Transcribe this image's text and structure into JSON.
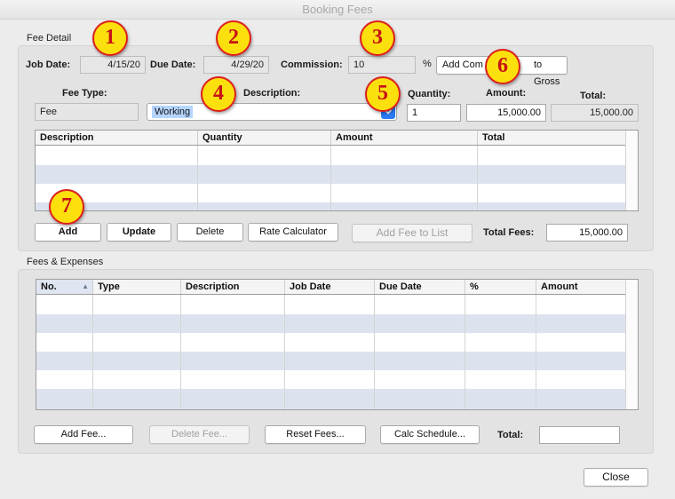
{
  "window": {
    "title": "Booking Fees"
  },
  "fee_detail": {
    "section_title": "Fee Detail",
    "job_date_label": "Job Date:",
    "job_date": "4/15/20",
    "due_date_label": "Due Date:",
    "due_date": "4/29/20",
    "commission_label": "Commission:",
    "commission": "10",
    "percent_sign": "%",
    "add_commission_button": "Add Com",
    "add_commission_button_tail": "to Gross",
    "fee_type_label": "Fee Type:",
    "fee_type": "Fee",
    "description_label": "Description:",
    "description": "Working",
    "quantity_label": "Quantity:",
    "quantity": "1",
    "amount_label": "Amount:",
    "amount": "15,000.00",
    "total_label": "Total:",
    "total": "15,000.00",
    "table_columns": [
      "Description",
      "Quantity",
      "Amount",
      "Total"
    ],
    "buttons": {
      "add": "Add",
      "update": "Update",
      "delete": "Delete",
      "rate_calculator": "Rate Calculator",
      "add_fee_to_list": "Add Fee to List"
    },
    "total_fees_label": "Total Fees:",
    "total_fees": "15,000.00"
  },
  "fees_expenses": {
    "section_title": "Fees & Expenses",
    "table_columns": [
      "No.",
      "Type",
      "Description",
      "Job Date",
      "Due Date",
      "%",
      "Amount"
    ],
    "buttons": {
      "add_fee": "Add Fee...",
      "delete_fee": "Delete Fee...",
      "reset_fees": "Reset Fees...",
      "calc_schedule": "Calc Schedule..."
    },
    "total_label": "Total:",
    "total": ""
  },
  "close_button": "Close",
  "callouts": [
    "1",
    "2",
    "3",
    "4",
    "5",
    "6",
    "7"
  ],
  "colors": {
    "callout_fill": "#fbe00e",
    "callout_border": "#dd1f1f",
    "callout_text": "#c71313",
    "selection": "#b5d5ff",
    "row_stripe": "#dde3ee",
    "accent": "#2b79f5"
  }
}
